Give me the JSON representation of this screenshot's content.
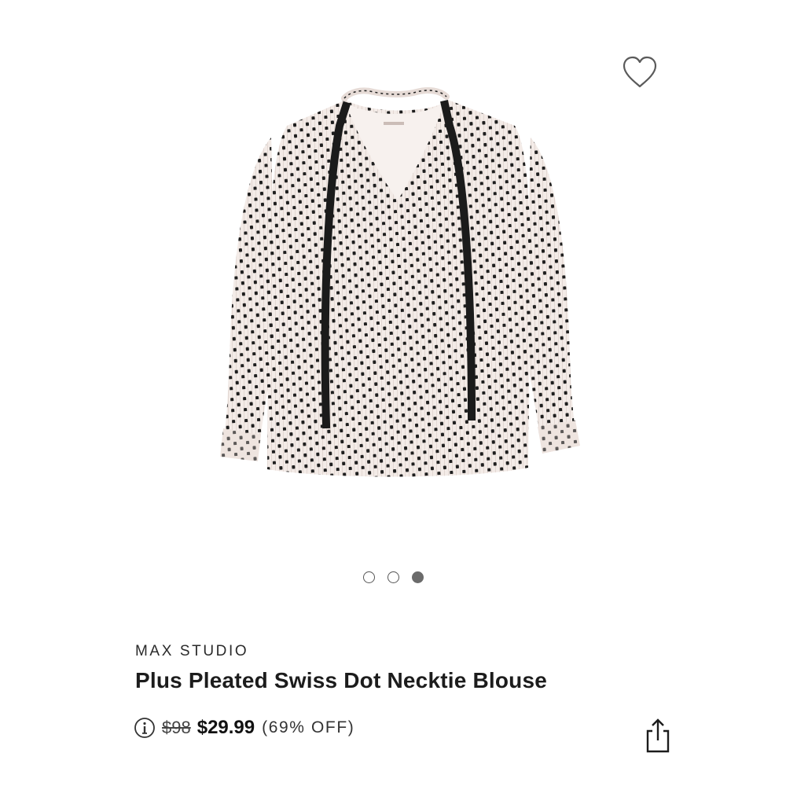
{
  "product": {
    "brand": "MAX STUDIO",
    "title": "Plus Pleated Swiss Dot Necktie Blouse",
    "original_price": "$98",
    "sale_price": "$29.99",
    "discount": "(69% OFF)",
    "image_alt": "Pleated Swiss dot necktie blouse in blush with black dots"
  },
  "gallery": {
    "image_count": 3,
    "active_index": 2
  },
  "icons": {
    "favorite": "heart-icon",
    "info": "info-icon",
    "share": "share-icon"
  },
  "colors": {
    "fabric": "#f3ebe7",
    "dots": "#1e1e1e",
    "tie": "#1b1b1b",
    "indicator_active": "#6b6b6b"
  }
}
